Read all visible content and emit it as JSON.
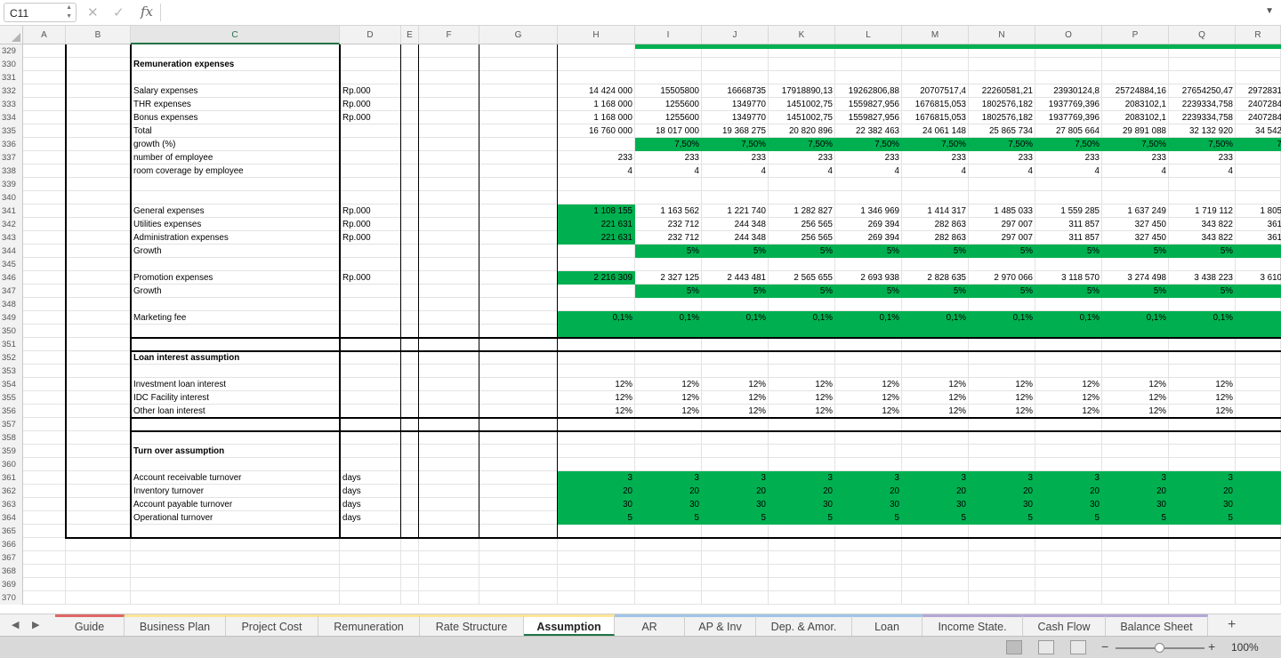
{
  "formula_bar": {
    "name_box": "C11",
    "fx_label": "fx",
    "content": ""
  },
  "columns": [
    "A",
    "B",
    "C",
    "D",
    "E",
    "F",
    "G",
    "H",
    "I",
    "J",
    "K",
    "L",
    "M",
    "N",
    "O",
    "P",
    "Q",
    "R"
  ],
  "selected_column": "C",
  "rows": [
    "329",
    "330",
    "331",
    "332",
    "333",
    "334",
    "335",
    "336",
    "337",
    "338",
    "339",
    "340",
    "341",
    "342",
    "343",
    "344",
    "345",
    "346",
    "347",
    "348",
    "349",
    "350",
    "351",
    "352",
    "353",
    "354",
    "355",
    "356",
    "357",
    "358",
    "359",
    "360",
    "361",
    "362",
    "363",
    "364",
    "365",
    "366",
    "367",
    "368",
    "369",
    "370"
  ],
  "cells": [
    {
      "row": "330",
      "col": "C",
      "v": "Remuneration expenses",
      "bold": true
    },
    {
      "row": "332",
      "col": "C",
      "v": "Salary expenses"
    },
    {
      "row": "333",
      "col": "C",
      "v": "THR expenses"
    },
    {
      "row": "334",
      "col": "C",
      "v": "Bonus expenses"
    },
    {
      "row": "335",
      "col": "C",
      "v": "Total"
    },
    {
      "row": "336",
      "col": "C",
      "v": "growth (%)"
    },
    {
      "row": "337",
      "col": "C",
      "v": "number of employee"
    },
    {
      "row": "338",
      "col": "C",
      "v": "room coverage by employee"
    },
    {
      "row": "341",
      "col": "C",
      "v": "General expenses"
    },
    {
      "row": "342",
      "col": "C",
      "v": "Utilities expenses"
    },
    {
      "row": "343",
      "col": "C",
      "v": "Administration expenses"
    },
    {
      "row": "344",
      "col": "C",
      "v": "Growth"
    },
    {
      "row": "346",
      "col": "C",
      "v": "Promotion expenses"
    },
    {
      "row": "347",
      "col": "C",
      "v": "Growth"
    },
    {
      "row": "349",
      "col": "C",
      "v": "Marketing fee"
    },
    {
      "row": "352",
      "col": "C",
      "v": "Loan interest assumption",
      "bold": true
    },
    {
      "row": "354",
      "col": "C",
      "v": "Investment loan interest"
    },
    {
      "row": "355",
      "col": "C",
      "v": "IDC Facility interest"
    },
    {
      "row": "356",
      "col": "C",
      "v": "Other loan interest"
    },
    {
      "row": "359",
      "col": "C",
      "v": "Turn over assumption",
      "bold": true
    },
    {
      "row": "361",
      "col": "C",
      "v": "Account receivable turnover"
    },
    {
      "row": "362",
      "col": "C",
      "v": "Inventory turnover"
    },
    {
      "row": "363",
      "col": "C",
      "v": "Account payable turnover"
    },
    {
      "row": "364",
      "col": "C",
      "v": "Operational turnover"
    },
    {
      "row": "332",
      "col": "D",
      "v": "Rp.000"
    },
    {
      "row": "333",
      "col": "D",
      "v": "Rp.000"
    },
    {
      "row": "334",
      "col": "D",
      "v": "Rp.000"
    },
    {
      "row": "341",
      "col": "D",
      "v": "Rp.000"
    },
    {
      "row": "342",
      "col": "D",
      "v": "Rp.000"
    },
    {
      "row": "343",
      "col": "D",
      "v": "Rp.000"
    },
    {
      "row": "346",
      "col": "D",
      "v": "Rp.000"
    },
    {
      "row": "361",
      "col": "D",
      "v": "days"
    },
    {
      "row": "362",
      "col": "D",
      "v": "days"
    },
    {
      "row": "363",
      "col": "D",
      "v": "days"
    },
    {
      "row": "364",
      "col": "D",
      "v": "days"
    },
    {
      "row": "332",
      "col": "H",
      "v": "14 424 000"
    },
    {
      "row": "333",
      "col": "H",
      "v": "1 168 000"
    },
    {
      "row": "334",
      "col": "H",
      "v": "1 168 000"
    },
    {
      "row": "335",
      "col": "H",
      "v": "16 760 000"
    },
    {
      "row": "337",
      "col": "H",
      "v": "233"
    },
    {
      "row": "338",
      "col": "H",
      "v": "4"
    },
    {
      "row": "341",
      "col": "H",
      "v": "1 108 155"
    },
    {
      "row": "342",
      "col": "H",
      "v": "221 631"
    },
    {
      "row": "343",
      "col": "H",
      "v": "221 631"
    },
    {
      "row": "346",
      "col": "H",
      "v": "2 216 309"
    },
    {
      "row": "349",
      "col": "H",
      "v": "0,1%"
    },
    {
      "row": "354",
      "col": "H",
      "v": "12%"
    },
    {
      "row": "355",
      "col": "H",
      "v": "12%"
    },
    {
      "row": "356",
      "col": "H",
      "v": "12%"
    },
    {
      "row": "361",
      "col": "H",
      "v": "3"
    },
    {
      "row": "362",
      "col": "H",
      "v": "20"
    },
    {
      "row": "363",
      "col": "H",
      "v": "30"
    },
    {
      "row": "364",
      "col": "H",
      "v": "5"
    },
    {
      "row": "332",
      "col": "I",
      "v": "15505800"
    },
    {
      "row": "333",
      "col": "I",
      "v": "1255600"
    },
    {
      "row": "334",
      "col": "I",
      "v": "1255600"
    },
    {
      "row": "335",
      "col": "I",
      "v": "18 017 000"
    },
    {
      "row": "336",
      "col": "I",
      "v": "7,50%"
    },
    {
      "row": "337",
      "col": "I",
      "v": "233"
    },
    {
      "row": "338",
      "col": "I",
      "v": "4"
    },
    {
      "row": "341",
      "col": "I",
      "v": "1 163 562"
    },
    {
      "row": "342",
      "col": "I",
      "v": "232 712"
    },
    {
      "row": "343",
      "col": "I",
      "v": "232 712"
    },
    {
      "row": "344",
      "col": "I",
      "v": "5%"
    },
    {
      "row": "346",
      "col": "I",
      "v": "2 327 125"
    },
    {
      "row": "347",
      "col": "I",
      "v": "5%"
    },
    {
      "row": "349",
      "col": "I",
      "v": "0,1%"
    },
    {
      "row": "354",
      "col": "I",
      "v": "12%"
    },
    {
      "row": "355",
      "col": "I",
      "v": "12%"
    },
    {
      "row": "356",
      "col": "I",
      "v": "12%"
    },
    {
      "row": "361",
      "col": "I",
      "v": "3"
    },
    {
      "row": "362",
      "col": "I",
      "v": "20"
    },
    {
      "row": "363",
      "col": "I",
      "v": "30"
    },
    {
      "row": "364",
      "col": "I",
      "v": "5"
    },
    {
      "row": "332",
      "col": "J",
      "v": "16668735"
    },
    {
      "row": "333",
      "col": "J",
      "v": "1349770"
    },
    {
      "row": "334",
      "col": "J",
      "v": "1349770"
    },
    {
      "row": "335",
      "col": "J",
      "v": "19 368 275"
    },
    {
      "row": "336",
      "col": "J",
      "v": "7,50%"
    },
    {
      "row": "337",
      "col": "J",
      "v": "233"
    },
    {
      "row": "338",
      "col": "J",
      "v": "4"
    },
    {
      "row": "341",
      "col": "J",
      "v": "1 221 740"
    },
    {
      "row": "342",
      "col": "J",
      "v": "244 348"
    },
    {
      "row": "343",
      "col": "J",
      "v": "244 348"
    },
    {
      "row": "344",
      "col": "J",
      "v": "5%"
    },
    {
      "row": "346",
      "col": "J",
      "v": "2 443 481"
    },
    {
      "row": "347",
      "col": "J",
      "v": "5%"
    },
    {
      "row": "349",
      "col": "J",
      "v": "0,1%"
    },
    {
      "row": "354",
      "col": "J",
      "v": "12%"
    },
    {
      "row": "355",
      "col": "J",
      "v": "12%"
    },
    {
      "row": "356",
      "col": "J",
      "v": "12%"
    },
    {
      "row": "361",
      "col": "J",
      "v": "3"
    },
    {
      "row": "362",
      "col": "J",
      "v": "20"
    },
    {
      "row": "363",
      "col": "J",
      "v": "30"
    },
    {
      "row": "364",
      "col": "J",
      "v": "5"
    },
    {
      "row": "332",
      "col": "K",
      "v": "17918890,13"
    },
    {
      "row": "333",
      "col": "K",
      "v": "1451002,75"
    },
    {
      "row": "334",
      "col": "K",
      "v": "1451002,75"
    },
    {
      "row": "335",
      "col": "K",
      "v": "20 820 896"
    },
    {
      "row": "336",
      "col": "K",
      "v": "7,50%"
    },
    {
      "row": "337",
      "col": "K",
      "v": "233"
    },
    {
      "row": "338",
      "col": "K",
      "v": "4"
    },
    {
      "row": "341",
      "col": "K",
      "v": "1 282 827"
    },
    {
      "row": "342",
      "col": "K",
      "v": "256 565"
    },
    {
      "row": "343",
      "col": "K",
      "v": "256 565"
    },
    {
      "row": "344",
      "col": "K",
      "v": "5%"
    },
    {
      "row": "346",
      "col": "K",
      "v": "2 565 655"
    },
    {
      "row": "347",
      "col": "K",
      "v": "5%"
    },
    {
      "row": "349",
      "col": "K",
      "v": "0,1%"
    },
    {
      "row": "354",
      "col": "K",
      "v": "12%"
    },
    {
      "row": "355",
      "col": "K",
      "v": "12%"
    },
    {
      "row": "356",
      "col": "K",
      "v": "12%"
    },
    {
      "row": "361",
      "col": "K",
      "v": "3"
    },
    {
      "row": "362",
      "col": "K",
      "v": "20"
    },
    {
      "row": "363",
      "col": "K",
      "v": "30"
    },
    {
      "row": "364",
      "col": "K",
      "v": "5"
    },
    {
      "row": "332",
      "col": "L",
      "v": "19262806,88"
    },
    {
      "row": "333",
      "col": "L",
      "v": "1559827,956"
    },
    {
      "row": "334",
      "col": "L",
      "v": "1559827,956"
    },
    {
      "row": "335",
      "col": "L",
      "v": "22 382 463"
    },
    {
      "row": "336",
      "col": "L",
      "v": "7,50%"
    },
    {
      "row": "337",
      "col": "L",
      "v": "233"
    },
    {
      "row": "338",
      "col": "L",
      "v": "4"
    },
    {
      "row": "341",
      "col": "L",
      "v": "1 346 969"
    },
    {
      "row": "342",
      "col": "L",
      "v": "269 394"
    },
    {
      "row": "343",
      "col": "L",
      "v": "269 394"
    },
    {
      "row": "344",
      "col": "L",
      "v": "5%"
    },
    {
      "row": "346",
      "col": "L",
      "v": "2 693 938"
    },
    {
      "row": "347",
      "col": "L",
      "v": "5%"
    },
    {
      "row": "349",
      "col": "L",
      "v": "0,1%"
    },
    {
      "row": "354",
      "col": "L",
      "v": "12%"
    },
    {
      "row": "355",
      "col": "L",
      "v": "12%"
    },
    {
      "row": "356",
      "col": "L",
      "v": "12%"
    },
    {
      "row": "361",
      "col": "L",
      "v": "3"
    },
    {
      "row": "362",
      "col": "L",
      "v": "20"
    },
    {
      "row": "363",
      "col": "L",
      "v": "30"
    },
    {
      "row": "364",
      "col": "L",
      "v": "5"
    },
    {
      "row": "332",
      "col": "M",
      "v": "20707517,4"
    },
    {
      "row": "333",
      "col": "M",
      "v": "1676815,053"
    },
    {
      "row": "334",
      "col": "M",
      "v": "1676815,053"
    },
    {
      "row": "335",
      "col": "M",
      "v": "24 061 148"
    },
    {
      "row": "336",
      "col": "M",
      "v": "7,50%"
    },
    {
      "row": "337",
      "col": "M",
      "v": "233"
    },
    {
      "row": "338",
      "col": "M",
      "v": "4"
    },
    {
      "row": "341",
      "col": "M",
      "v": "1 414 317"
    },
    {
      "row": "342",
      "col": "M",
      "v": "282 863"
    },
    {
      "row": "343",
      "col": "M",
      "v": "282 863"
    },
    {
      "row": "344",
      "col": "M",
      "v": "5%"
    },
    {
      "row": "346",
      "col": "M",
      "v": "2 828 635"
    },
    {
      "row": "347",
      "col": "M",
      "v": "5%"
    },
    {
      "row": "349",
      "col": "M",
      "v": "0,1%"
    },
    {
      "row": "354",
      "col": "M",
      "v": "12%"
    },
    {
      "row": "355",
      "col": "M",
      "v": "12%"
    },
    {
      "row": "356",
      "col": "M",
      "v": "12%"
    },
    {
      "row": "361",
      "col": "M",
      "v": "3"
    },
    {
      "row": "362",
      "col": "M",
      "v": "20"
    },
    {
      "row": "363",
      "col": "M",
      "v": "30"
    },
    {
      "row": "364",
      "col": "M",
      "v": "5"
    },
    {
      "row": "332",
      "col": "N",
      "v": "22260581,21"
    },
    {
      "row": "333",
      "col": "N",
      "v": "1802576,182"
    },
    {
      "row": "334",
      "col": "N",
      "v": "1802576,182"
    },
    {
      "row": "335",
      "col": "N",
      "v": "25 865 734"
    },
    {
      "row": "336",
      "col": "N",
      "v": "7,50%"
    },
    {
      "row": "337",
      "col": "N",
      "v": "233"
    },
    {
      "row": "338",
      "col": "N",
      "v": "4"
    },
    {
      "row": "341",
      "col": "N",
      "v": "1 485 033"
    },
    {
      "row": "342",
      "col": "N",
      "v": "297 007"
    },
    {
      "row": "343",
      "col": "N",
      "v": "297 007"
    },
    {
      "row": "344",
      "col": "N",
      "v": "5%"
    },
    {
      "row": "346",
      "col": "N",
      "v": "2 970 066"
    },
    {
      "row": "347",
      "col": "N",
      "v": "5%"
    },
    {
      "row": "349",
      "col": "N",
      "v": "0,1%"
    },
    {
      "row": "354",
      "col": "N",
      "v": "12%"
    },
    {
      "row": "355",
      "col": "N",
      "v": "12%"
    },
    {
      "row": "356",
      "col": "N",
      "v": "12%"
    },
    {
      "row": "361",
      "col": "N",
      "v": "3"
    },
    {
      "row": "362",
      "col": "N",
      "v": "20"
    },
    {
      "row": "363",
      "col": "N",
      "v": "30"
    },
    {
      "row": "364",
      "col": "N",
      "v": "5"
    },
    {
      "row": "332",
      "col": "O",
      "v": "23930124,8"
    },
    {
      "row": "333",
      "col": "O",
      "v": "1937769,396"
    },
    {
      "row": "334",
      "col": "O",
      "v": "1937769,396"
    },
    {
      "row": "335",
      "col": "O",
      "v": "27 805 664"
    },
    {
      "row": "336",
      "col": "O",
      "v": "7,50%"
    },
    {
      "row": "337",
      "col": "O",
      "v": "233"
    },
    {
      "row": "338",
      "col": "O",
      "v": "4"
    },
    {
      "row": "341",
      "col": "O",
      "v": "1 559 285"
    },
    {
      "row": "342",
      "col": "O",
      "v": "311 857"
    },
    {
      "row": "343",
      "col": "O",
      "v": "311 857"
    },
    {
      "row": "344",
      "col": "O",
      "v": "5%"
    },
    {
      "row": "346",
      "col": "O",
      "v": "3 118 570"
    },
    {
      "row": "347",
      "col": "O",
      "v": "5%"
    },
    {
      "row": "349",
      "col": "O",
      "v": "0,1%"
    },
    {
      "row": "354",
      "col": "O",
      "v": "12%"
    },
    {
      "row": "355",
      "col": "O",
      "v": "12%"
    },
    {
      "row": "356",
      "col": "O",
      "v": "12%"
    },
    {
      "row": "361",
      "col": "O",
      "v": "3"
    },
    {
      "row": "362",
      "col": "O",
      "v": "20"
    },
    {
      "row": "363",
      "col": "O",
      "v": "30"
    },
    {
      "row": "364",
      "col": "O",
      "v": "5"
    },
    {
      "row": "332",
      "col": "P",
      "v": "25724884,16"
    },
    {
      "row": "333",
      "col": "P",
      "v": "2083102,1"
    },
    {
      "row": "334",
      "col": "P",
      "v": "2083102,1"
    },
    {
      "row": "335",
      "col": "P",
      "v": "29 891 088"
    },
    {
      "row": "336",
      "col": "P",
      "v": "7,50%"
    },
    {
      "row": "337",
      "col": "P",
      "v": "233"
    },
    {
      "row": "338",
      "col": "P",
      "v": "4"
    },
    {
      "row": "341",
      "col": "P",
      "v": "1 637 249"
    },
    {
      "row": "342",
      "col": "P",
      "v": "327 450"
    },
    {
      "row": "343",
      "col": "P",
      "v": "327 450"
    },
    {
      "row": "344",
      "col": "P",
      "v": "5%"
    },
    {
      "row": "346",
      "col": "P",
      "v": "3 274 498"
    },
    {
      "row": "347",
      "col": "P",
      "v": "5%"
    },
    {
      "row": "349",
      "col": "P",
      "v": "0,1%"
    },
    {
      "row": "354",
      "col": "P",
      "v": "12%"
    },
    {
      "row": "355",
      "col": "P",
      "v": "12%"
    },
    {
      "row": "356",
      "col": "P",
      "v": "12%"
    },
    {
      "row": "361",
      "col": "P",
      "v": "3"
    },
    {
      "row": "362",
      "col": "P",
      "v": "20"
    },
    {
      "row": "363",
      "col": "P",
      "v": "30"
    },
    {
      "row": "364",
      "col": "P",
      "v": "5"
    },
    {
      "row": "332",
      "col": "Q",
      "v": "27654250,47"
    },
    {
      "row": "333",
      "col": "Q",
      "v": "2239334,758"
    },
    {
      "row": "334",
      "col": "Q",
      "v": "2239334,758"
    },
    {
      "row": "335",
      "col": "Q",
      "v": "32 132 920"
    },
    {
      "row": "336",
      "col": "Q",
      "v": "7,50%"
    },
    {
      "row": "337",
      "col": "Q",
      "v": "233"
    },
    {
      "row": "338",
      "col": "Q",
      "v": "4"
    },
    {
      "row": "341",
      "col": "Q",
      "v": "1 719 112"
    },
    {
      "row": "342",
      "col": "Q",
      "v": "343 822"
    },
    {
      "row": "343",
      "col": "Q",
      "v": "343 822"
    },
    {
      "row": "344",
      "col": "Q",
      "v": "5%"
    },
    {
      "row": "346",
      "col": "Q",
      "v": "3 438 223"
    },
    {
      "row": "347",
      "col": "Q",
      "v": "5%"
    },
    {
      "row": "349",
      "col": "Q",
      "v": "0,1%"
    },
    {
      "row": "354",
      "col": "Q",
      "v": "12%"
    },
    {
      "row": "355",
      "col": "Q",
      "v": "12%"
    },
    {
      "row": "356",
      "col": "Q",
      "v": "12%"
    },
    {
      "row": "361",
      "col": "Q",
      "v": "3"
    },
    {
      "row": "362",
      "col": "Q",
      "v": "20"
    },
    {
      "row": "363",
      "col": "Q",
      "v": "30"
    },
    {
      "row": "364",
      "col": "Q",
      "v": "5"
    },
    {
      "row": "332",
      "col": "R",
      "v": "2972831"
    },
    {
      "row": "333",
      "col": "R",
      "v": "2407284"
    },
    {
      "row": "334",
      "col": "R",
      "v": "2407284"
    },
    {
      "row": "335",
      "col": "R",
      "v": "34 542"
    },
    {
      "row": "336",
      "col": "R",
      "v": "7"
    },
    {
      "row": "341",
      "col": "R",
      "v": "1 805"
    },
    {
      "row": "342",
      "col": "R",
      "v": "361"
    },
    {
      "row": "343",
      "col": "R",
      "v": "361"
    },
    {
      "row": "346",
      "col": "R",
      "v": "3 610"
    }
  ],
  "sheet_tabs": [
    {
      "label": "Guide",
      "color": "#e06666"
    },
    {
      "label": "Business Plan",
      "color": "#ffe599"
    },
    {
      "label": "Project Cost",
      "color": "#ffe599"
    },
    {
      "label": "Remuneration",
      "color": "#ffe599"
    },
    {
      "label": "Rate Structure",
      "color": "#ffe599"
    },
    {
      "label": "Assumption",
      "color": "#ffe599",
      "active": true
    },
    {
      "label": "AR",
      "color": "#9fc5e8"
    },
    {
      "label": "AP & Inv",
      "color": "#9fc5e8"
    },
    {
      "label": "Dep. & Amor.",
      "color": "#9fc5e8"
    },
    {
      "label": "Loan",
      "color": "#9fc5e8"
    },
    {
      "label": "Income State.",
      "color": "#b4a7d6"
    },
    {
      "label": "Cash Flow",
      "color": "#b4a7d6"
    },
    {
      "label": "Balance Sheet",
      "color": "#b4a7d6"
    }
  ],
  "add_sheet_label": "+",
  "zoom": {
    "minus": "−",
    "plus": "+",
    "level": "100%",
    "fraction": 0.5
  }
}
